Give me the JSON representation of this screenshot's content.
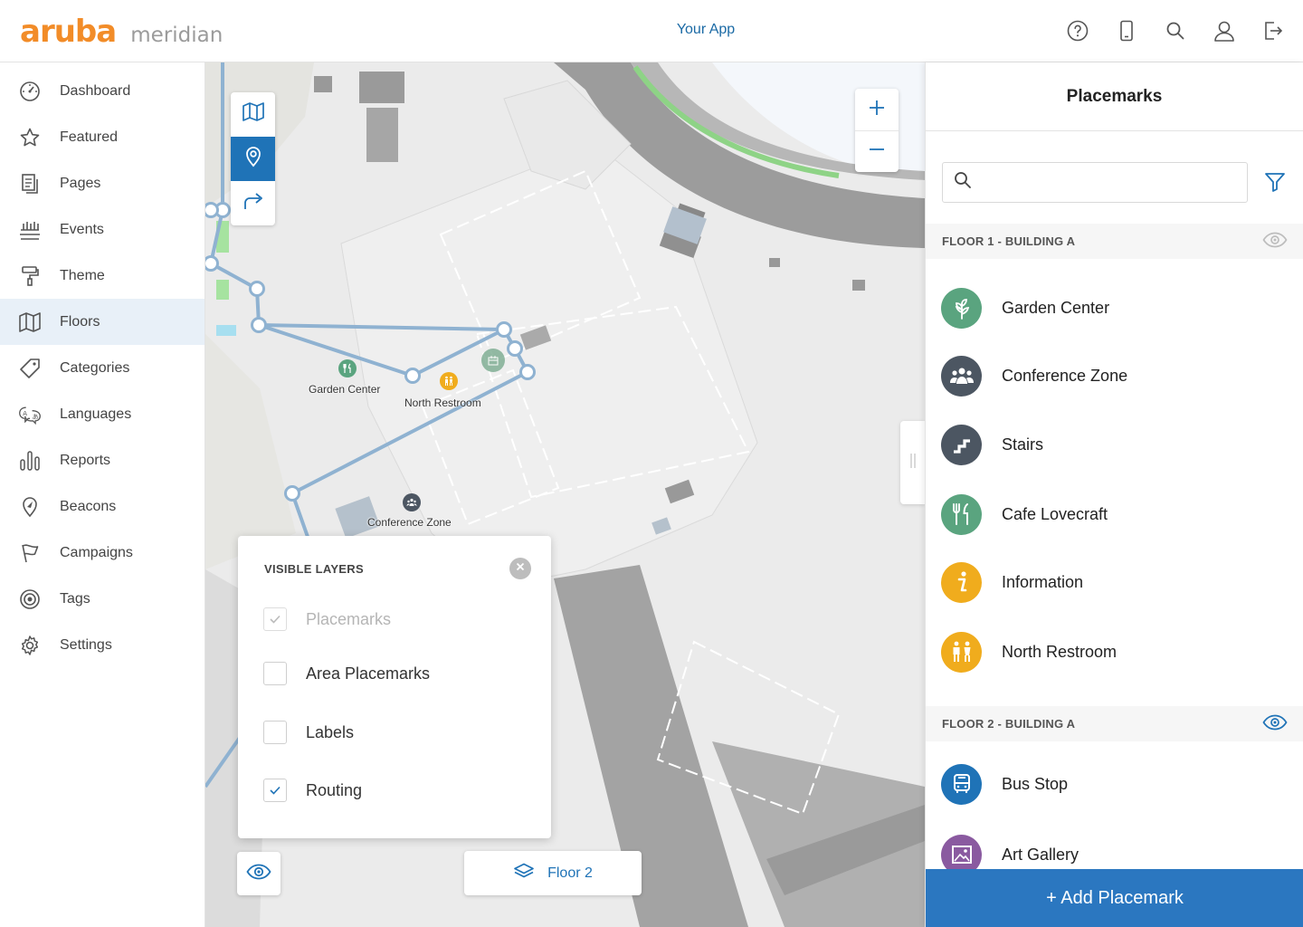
{
  "header": {
    "logo_primary": "aruba",
    "logo_secondary": "meridian",
    "app_name": "Your App",
    "icons": [
      "help-icon",
      "mobile-icon",
      "search-icon",
      "user-icon",
      "logout-icon"
    ]
  },
  "sidebar": {
    "items": [
      {
        "label": "Dashboard",
        "icon": "gauge-icon"
      },
      {
        "label": "Featured",
        "icon": "star-icon"
      },
      {
        "label": "Pages",
        "icon": "pages-icon"
      },
      {
        "label": "Events",
        "icon": "calendar-icon"
      },
      {
        "label": "Theme",
        "icon": "paint-roller-icon"
      },
      {
        "label": "Floors",
        "icon": "map-icon",
        "active": true
      },
      {
        "label": "Categories",
        "icon": "tag-icon"
      },
      {
        "label": "Languages",
        "icon": "languages-icon"
      },
      {
        "label": "Reports",
        "icon": "bar-chart-icon"
      },
      {
        "label": "Beacons",
        "icon": "location-arrow-icon"
      },
      {
        "label": "Campaigns",
        "icon": "flag-icon"
      },
      {
        "label": "Tags",
        "icon": "target-icon"
      },
      {
        "label": "Settings",
        "icon": "gear-icon"
      }
    ]
  },
  "map": {
    "labels": {
      "garden_center": "Garden Center",
      "north_restroom": "North Restroom",
      "conference_zone": "Conference Zone"
    },
    "layers_panel": {
      "title": "VISIBLE LAYERS",
      "layers": [
        {
          "label": "Placemarks",
          "checked": true,
          "disabled": true
        },
        {
          "label": "Area Placemarks",
          "checked": false,
          "disabled": false
        },
        {
          "label": "Labels",
          "checked": false,
          "disabled": false
        },
        {
          "label": "Routing",
          "checked": true,
          "disabled": false
        }
      ]
    },
    "floor_button": "Floor 2"
  },
  "placemarks": {
    "title": "Placemarks",
    "search_placeholder": "",
    "floors": [
      {
        "name": "FLOOR 1 - BUILDING A",
        "visible": false,
        "items": [
          {
            "label": "Garden Center",
            "color": "#5aa47f",
            "icon": "leaf-icon"
          },
          {
            "label": "Conference Zone",
            "color": "#4c5662",
            "icon": "people-icon"
          },
          {
            "label": "Stairs",
            "color": "#4c5662",
            "icon": "stairs-icon"
          },
          {
            "label": "Cafe Lovecraft",
            "color": "#5aa47f",
            "icon": "fork-knife-icon"
          },
          {
            "label": "Information",
            "color": "#f0ac1d",
            "icon": "info-icon"
          },
          {
            "label": "North Restroom",
            "color": "#f0ac1d",
            "icon": "restroom-icon"
          }
        ]
      },
      {
        "name": "FLOOR 2 - BUILDING A",
        "visible": true,
        "items": [
          {
            "label": "Bus Stop",
            "color": "#1f73b7",
            "icon": "bus-icon"
          },
          {
            "label": "Art Gallery",
            "color": "#8a5aa0",
            "icon": "picture-icon"
          }
        ]
      }
    ],
    "add_button": "+ Add Placemark"
  }
}
